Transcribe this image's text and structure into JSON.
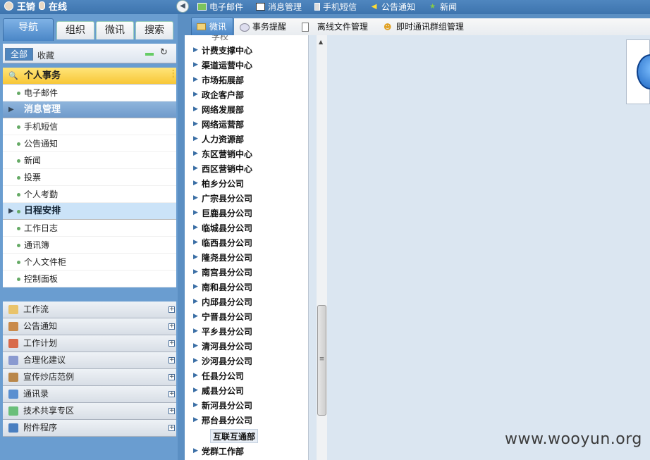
{
  "topbar": {
    "user_name": "王锜",
    "status": "在线",
    "links": [
      "电子邮件",
      "消息管理",
      "手机短信",
      "公告通知",
      "新闻"
    ]
  },
  "left_tabs": [
    "导航",
    "组织",
    "微讯",
    "搜索"
  ],
  "filter": {
    "all_label": "全部",
    "favorites_label": "收藏"
  },
  "tree": {
    "personal": "个人事务",
    "email": "电子邮件",
    "msg_mgmt": "消息管理",
    "items_a": [
      "手机短信",
      "公告通知",
      "新闻",
      "投票",
      "个人考勤"
    ],
    "schedule": "日程安排",
    "items_b": [
      "工作日志",
      "通讯簿",
      "个人文件柜",
      "控制面板"
    ]
  },
  "accordion": [
    "工作流",
    "公告通知",
    "工作计划",
    "合理化建议",
    "宣传炒店范例",
    "通讯录",
    "技术共享专区",
    "附件程序"
  ],
  "work_tabs": [
    "微讯",
    "事务提醒",
    "离线文件管理",
    "即时通讯群组管理"
  ],
  "dept_partial": "学校",
  "departments": [
    "计费支撑中心",
    "渠道运营中心",
    "市场拓展部",
    "政企客户部",
    "网络发展部",
    "网络运营部",
    "人力资源部",
    "东区营销中心",
    "西区营销中心",
    "柏乡分公司",
    "广宗县分公司",
    "巨鹿县分公司",
    "临城县分公司",
    "临西县分公司",
    "隆尧县分公司",
    "南宫县分公司",
    "南和县分公司",
    "内邱县分公司",
    "宁晋县分公司",
    "平乡县分公司",
    "清河县分公司",
    "沙河县分公司",
    "任县分公司",
    "威县分公司",
    "新河县分公司",
    "邢台县分公司"
  ],
  "selected_dept": "互联互通部",
  "last_dept": "党群工作部",
  "watermark": "www.wooyun.org"
}
